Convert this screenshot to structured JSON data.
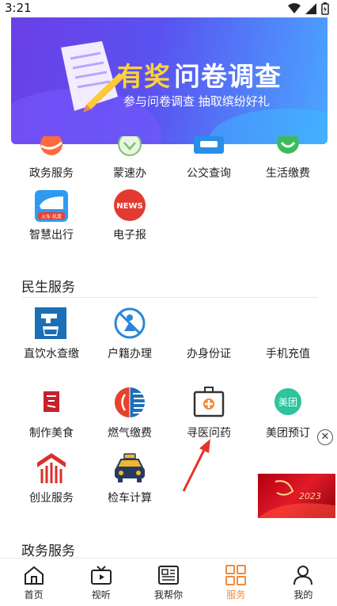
{
  "status_bar": {
    "time": "3:21"
  },
  "banner": {
    "title_highlight": "有奖",
    "title_rest": "问卷调查",
    "subtitle": "参与问卷调查  抽取缤纷好礼"
  },
  "top_grid": {
    "items": [
      {
        "label": "政务服务",
        "icon": "government-icon"
      },
      {
        "label": "蒙速办",
        "icon": "mengsuban-icon"
      },
      {
        "label": "公交查询",
        "icon": "bus-icon"
      },
      {
        "label": "生活缴费",
        "icon": "payment-icon"
      },
      {
        "label": "智慧出行",
        "icon": "train-icon",
        "badge": "火车·机票"
      },
      {
        "label": "电子报",
        "icon": "news-icon",
        "badge": "NEWS"
      }
    ]
  },
  "minsheng": {
    "title": "民生服务",
    "items": [
      {
        "label": "直饮水查缴",
        "icon": "water-tap-icon"
      },
      {
        "label": "户籍办理",
        "icon": "household-icon"
      },
      {
        "label": "办身份证",
        "icon": "id-card-icon"
      },
      {
        "label": "手机充值",
        "icon": "phone-topup-icon"
      },
      {
        "label": "制作美食",
        "icon": "food-icon"
      },
      {
        "label": "燃气缴费",
        "icon": "gas-icon"
      },
      {
        "label": "寻医问药",
        "icon": "medical-kit-icon"
      },
      {
        "label": "美团预订",
        "icon": "meituan-icon",
        "badge": "美团"
      },
      {
        "label": "创业服务",
        "icon": "startup-icon"
      },
      {
        "label": "检车计算",
        "icon": "taxi-icon"
      }
    ]
  },
  "next_section": {
    "title": "政务服务"
  },
  "floating": {
    "close_glyph": "✕",
    "promo_text": "2023"
  },
  "bottom_nav": {
    "items": [
      {
        "label": "首页",
        "icon": "home-icon",
        "active": false
      },
      {
        "label": "视听",
        "icon": "video-icon",
        "active": false
      },
      {
        "label": "我帮你",
        "icon": "newspaper-icon",
        "active": false
      },
      {
        "label": "服务",
        "icon": "grid-icon",
        "active": true
      },
      {
        "label": "我的",
        "icon": "user-icon",
        "active": false
      }
    ]
  },
  "colors": {
    "accent": "#f08a3c",
    "banner_start": "#6a3fe6",
    "banner_end": "#4aa6ff",
    "title_yellow": "#ffd23a"
  }
}
